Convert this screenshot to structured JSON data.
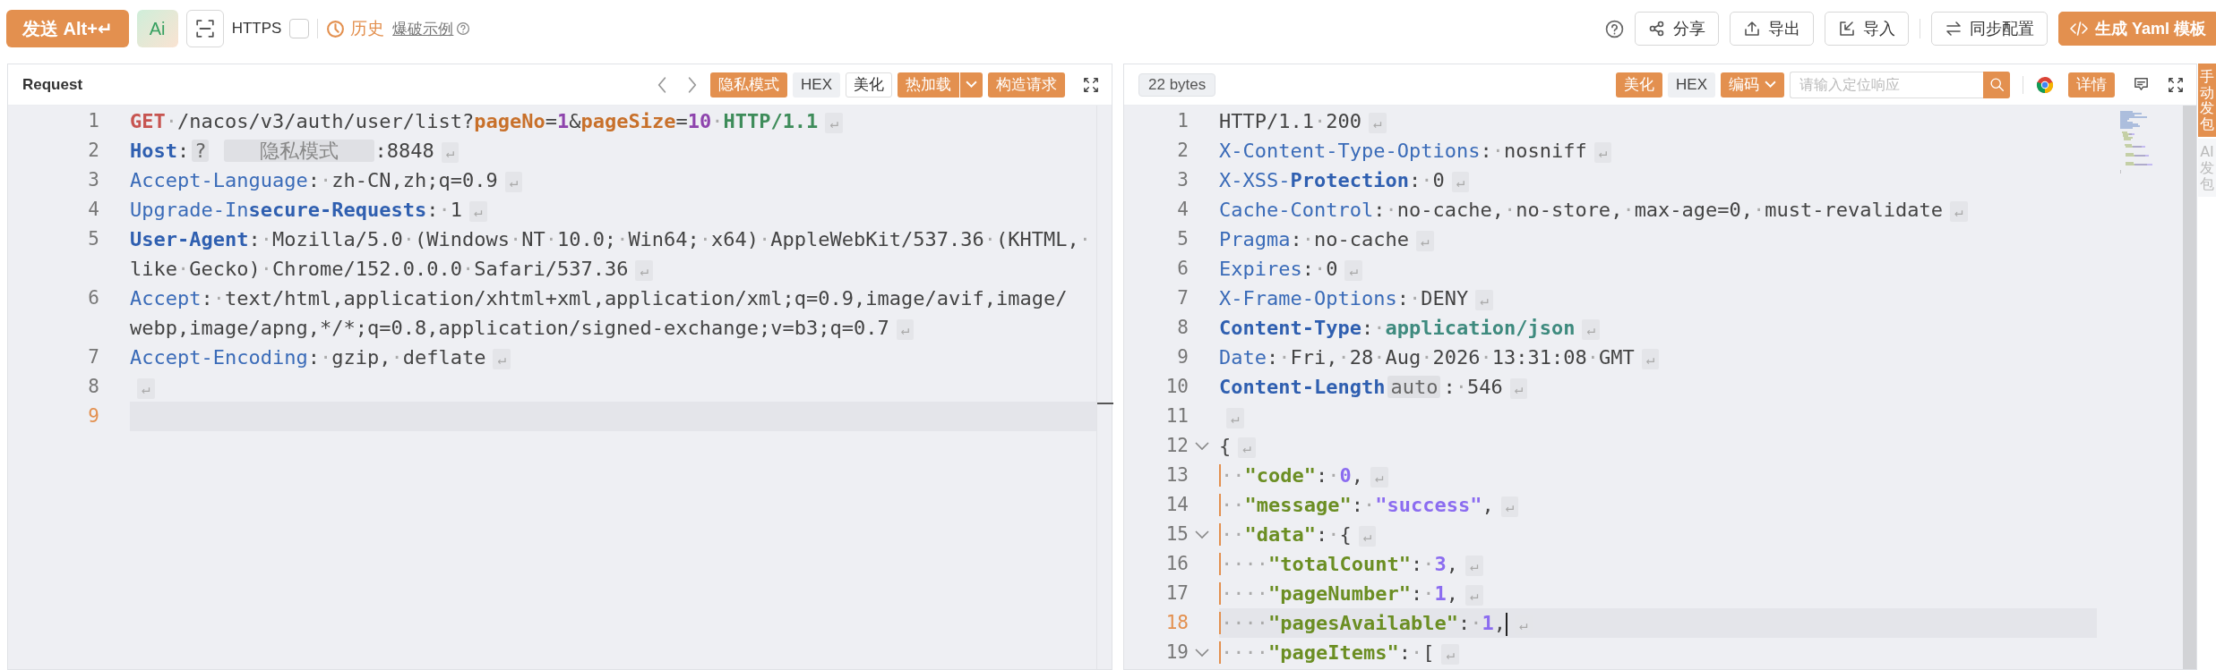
{
  "toolbar": {
    "send": {
      "label": "发送 Alt+↵"
    },
    "ai": {
      "label": "Ai"
    },
    "https": {
      "label": "HTTPS",
      "checked": false
    },
    "history": {
      "label": "历史"
    },
    "example": {
      "label": "爆破示例"
    },
    "actions": [
      {
        "label": "分享",
        "kind": "plain"
      },
      {
        "label": "导出",
        "kind": "plain"
      },
      {
        "label": "导入",
        "kind": "plain"
      },
      {
        "label": "同步配置",
        "kind": "plain"
      },
      {
        "label": "生成 Yaml 模板",
        "kind": "primary"
      }
    ]
  },
  "request": {
    "title": "Request",
    "buttons": [
      {
        "label": "隐私模式",
        "kind": "primary"
      },
      {
        "label": "HEX",
        "kind": "muted"
      },
      {
        "label": "美化",
        "kind": "outline"
      },
      {
        "label": "热加载",
        "kind": "primary",
        "menu": true
      },
      {
        "label": "构造请求",
        "kind": "primary"
      }
    ],
    "lines": [
      {
        "n": "1",
        "current": false,
        "tokens": [
          {
            "kind": "method",
            "text": "GET"
          },
          {
            "kind": "value",
            "text": "·/nacos/v3/auth/user/list?"
          },
          {
            "kind": "param",
            "text": "pageNo"
          },
          {
            "kind": "value",
            "text": "="
          },
          {
            "kind": "num",
            "text": "1"
          },
          {
            "kind": "value",
            "text": "&"
          },
          {
            "kind": "param",
            "text": "pageSize"
          },
          {
            "kind": "value",
            "text": "="
          },
          {
            "kind": "num",
            "text": "10"
          },
          {
            "kind": "value",
            "text": "·"
          },
          {
            "kind": "version",
            "text": "HTTP/1.1"
          },
          {
            "kind": "eol",
            "text": "↵"
          }
        ]
      },
      {
        "n": "2",
        "current": false,
        "tokens": [
          {
            "kind": "keyb",
            "text": "Host"
          },
          {
            "kind": "punct",
            "text": ":"
          },
          {
            "kind": "tag",
            "text": "?"
          },
          {
            "kind": "mask",
            "text": "隐私模式"
          },
          {
            "kind": "value",
            "text": ":8848"
          },
          {
            "kind": "eol",
            "text": "↵"
          }
        ]
      },
      {
        "n": "3",
        "current": false,
        "tokens": [
          {
            "kind": "key",
            "text": "Accept-Language"
          },
          {
            "kind": "punct",
            "text": ":"
          },
          {
            "kind": "value",
            "text": "·zh-CN,zh;q=0.9"
          },
          {
            "kind": "eol",
            "text": "↵"
          }
        ]
      },
      {
        "n": "4",
        "current": false,
        "tokens": [
          {
            "kind": "key",
            "text": "Upgrade-In"
          },
          {
            "kind": "keyb",
            "text": "secure-Requests"
          },
          {
            "kind": "punct",
            "text": ":"
          },
          {
            "kind": "value",
            "text": "·1"
          },
          {
            "kind": "eol",
            "text": "↵"
          }
        ]
      },
      {
        "n": "5",
        "current": false,
        "tokens": [
          {
            "kind": "keyb",
            "text": "User-Agent"
          },
          {
            "kind": "punct",
            "text": ":"
          },
          {
            "kind": "value",
            "text": "·Mozilla/5.0·(Windows·NT·10.0;·Win64;·x64)·AppleWebKit/537.36·(KHTML,·like·Gecko)·Chrome/152.0.0.0·Safari/537.36"
          },
          {
            "kind": "eol",
            "text": "↵"
          }
        ]
      },
      {
        "n": "6",
        "current": false,
        "tokens": [
          {
            "kind": "key",
            "text": "Accept"
          },
          {
            "kind": "punct",
            "text": ":"
          },
          {
            "kind": "value",
            "text": "·text/html,application/xhtml+xml,application/xml;q=0.9,image/avif,image/webp,image/apng,*/*;q=0.8,application/signed-exchange;v=b3;q=0.7"
          },
          {
            "kind": "eol",
            "text": "↵"
          }
        ]
      },
      {
        "n": "7",
        "current": false,
        "tokens": [
          {
            "kind": "key",
            "text": "Accept-Encoding"
          },
          {
            "kind": "punct",
            "text": ":"
          },
          {
            "kind": "value",
            "text": "·gzip,·deflate"
          },
          {
            "kind": "eol",
            "text": "↵"
          }
        ]
      },
      {
        "n": "8",
        "current": false,
        "tokens": [
          {
            "kind": "eol",
            "text": "↵"
          }
        ]
      },
      {
        "n": "9",
        "current": true
      }
    ]
  },
  "response": {
    "size": "22 bytes",
    "buttons": [
      {
        "label": "美化",
        "kind": "primary"
      },
      {
        "label": "HEX",
        "kind": "muted"
      },
      {
        "label": "编码",
        "kind": "primary",
        "menu": true
      }
    ],
    "search": {
      "placeholder": "请输入定位响应"
    },
    "detail": {
      "label": "详情"
    },
    "lines": [
      {
        "n": "1",
        "current": false,
        "tokens": [
          {
            "kind": "value",
            "text": "HTTP/1.1·200"
          },
          {
            "kind": "eol",
            "text": "↵"
          }
        ]
      },
      {
        "n": "2",
        "current": false,
        "tokens": [
          {
            "kind": "key",
            "text": "X-Content-Type-Options"
          },
          {
            "kind": "punct",
            "text": ":"
          },
          {
            "kind": "value",
            "text": "·nosniff"
          },
          {
            "kind": "eol",
            "text": "↵"
          }
        ]
      },
      {
        "n": "3",
        "current": false,
        "tokens": [
          {
            "kind": "key",
            "text": "X-XSS-"
          },
          {
            "kind": "keyb",
            "text": "Protection"
          },
          {
            "kind": "punct",
            "text": ":"
          },
          {
            "kind": "value",
            "text": "·0"
          },
          {
            "kind": "eol",
            "text": "↵"
          }
        ]
      },
      {
        "n": "4",
        "current": false,
        "tokens": [
          {
            "kind": "key",
            "text": "Cache-Control"
          },
          {
            "kind": "punct",
            "text": ":"
          },
          {
            "kind": "value",
            "text": "·no-cache,·no-store,·max-age=0,·must-revalidate"
          },
          {
            "kind": "eol",
            "text": "↵"
          }
        ]
      },
      {
        "n": "5",
        "current": false,
        "tokens": [
          {
            "kind": "key",
            "text": "Pragma"
          },
          {
            "kind": "punct",
            "text": ":"
          },
          {
            "kind": "value",
            "text": "·no-cache"
          },
          {
            "kind": "eol",
            "text": "↵"
          }
        ]
      },
      {
        "n": "6",
        "current": false,
        "tokens": [
          {
            "kind": "key",
            "text": "Expires"
          },
          {
            "kind": "punct",
            "text": ":"
          },
          {
            "kind": "value",
            "text": "·0"
          },
          {
            "kind": "eol",
            "text": "↵"
          }
        ]
      },
      {
        "n": "7",
        "current": false,
        "tokens": [
          {
            "kind": "key",
            "text": "X-Frame-Options"
          },
          {
            "kind": "punct",
            "text": ":"
          },
          {
            "kind": "value",
            "text": "·DENY"
          },
          {
            "kind": "eol",
            "text": "↵"
          }
        ]
      },
      {
        "n": "8",
        "current": false,
        "tokens": [
          {
            "kind": "keyb",
            "text": "Content-Type"
          },
          {
            "kind": "punct",
            "text": ":"
          },
          {
            "kind": "value",
            "text": "·"
          },
          {
            "kind": "ctype",
            "text": "application/json"
          },
          {
            "kind": "eol",
            "text": "↵"
          }
        ]
      },
      {
        "n": "9",
        "current": false,
        "tokens": [
          {
            "kind": "key",
            "text": "Date"
          },
          {
            "kind": "punct",
            "text": ":"
          },
          {
            "kind": "value",
            "text": "·Fri,·28·Aug·2026·13:31:08·GMT"
          },
          {
            "kind": "eol",
            "text": "↵"
          }
        ]
      },
      {
        "n": "10",
        "current": false,
        "tokens": [
          {
            "kind": "keyb",
            "text": "Content-Length"
          },
          {
            "kind": "tag",
            "text": "auto"
          },
          {
            "kind": "punct",
            "text": ":"
          },
          {
            "kind": "value",
            "text": "·546"
          },
          {
            "kind": "eol",
            "text": "↵"
          }
        ]
      },
      {
        "n": "11",
        "current": false,
        "tokens": [
          {
            "kind": "eol",
            "text": "↵"
          }
        ]
      },
      {
        "n": "12",
        "current": false,
        "expanded": true,
        "tokens": [
          {
            "kind": "brace",
            "text": "{"
          },
          {
            "kind": "eol",
            "text": "↵"
          }
        ]
      },
      {
        "n": "13",
        "current": false,
        "tokens": [
          {
            "kind": "indent",
            "text": "··"
          },
          {
            "kind": "jkey",
            "text": "\"code\""
          },
          {
            "kind": "punct",
            "text": ":"
          },
          {
            "kind": "value",
            "text": "·"
          },
          {
            "kind": "jnum",
            "text": "0"
          },
          {
            "kind": "punct",
            "text": ","
          },
          {
            "kind": "eol",
            "text": "↵"
          }
        ]
      },
      {
        "n": "14",
        "current": false,
        "tokens": [
          {
            "kind": "indent",
            "text": "··"
          },
          {
            "kind": "jkey",
            "text": "\"message\""
          },
          {
            "kind": "punct",
            "text": ":"
          },
          {
            "kind": "value",
            "text": "·"
          },
          {
            "kind": "jstr",
            "text": "\"success\""
          },
          {
            "kind": "punct",
            "text": ","
          },
          {
            "kind": "eol",
            "text": "↵"
          }
        ]
      },
      {
        "n": "15",
        "current": false,
        "expanded": true,
        "tokens": [
          {
            "kind": "indent",
            "text": "··"
          },
          {
            "kind": "jkey",
            "text": "\"data\""
          },
          {
            "kind": "punct",
            "text": ":"
          },
          {
            "kind": "value",
            "text": "·"
          },
          {
            "kind": "brace",
            "text": "{"
          },
          {
            "kind": "eol",
            "text": "↵"
          }
        ]
      },
      {
        "n": "16",
        "current": false,
        "tokens": [
          {
            "kind": "indent",
            "text": "····"
          },
          {
            "kind": "jkey",
            "text": "\"totalCount\""
          },
          {
            "kind": "punct",
            "text": ":"
          },
          {
            "kind": "value",
            "text": "·"
          },
          {
            "kind": "jnum",
            "text": "3"
          },
          {
            "kind": "punct",
            "text": ","
          },
          {
            "kind": "eol",
            "text": "↵"
          }
        ]
      },
      {
        "n": "17",
        "current": false,
        "tokens": [
          {
            "kind": "indent",
            "text": "····"
          },
          {
            "kind": "jkey",
            "text": "\"pageNumber\""
          },
          {
            "kind": "punct",
            "text": ":"
          },
          {
            "kind": "value",
            "text": "·"
          },
          {
            "kind": "jnum",
            "text": "1"
          },
          {
            "kind": "punct",
            "text": ","
          },
          {
            "kind": "eol",
            "text": "↵"
          }
        ]
      },
      {
        "n": "18",
        "current": true,
        "tokens": [
          {
            "kind": "indent",
            "text": "····"
          },
          {
            "kind": "jkey",
            "text": "\"pagesAvailable\""
          },
          {
            "kind": "punct",
            "text": ":"
          },
          {
            "kind": "value",
            "text": "·"
          },
          {
            "kind": "jnum",
            "text": "1"
          },
          {
            "kind": "punct",
            "text": ","
          },
          {
            "kind": "cursor"
          },
          {
            "kind": "eol",
            "text": "↵"
          }
        ]
      },
      {
        "n": "19",
        "current": false,
        "expanded": true,
        "tokens": [
          {
            "kind": "indent",
            "text": "····"
          },
          {
            "kind": "jkey",
            "text": "\"pageItems\""
          },
          {
            "kind": "punct",
            "text": ":"
          },
          {
            "kind": "value",
            "text": "·"
          },
          {
            "kind": "brace",
            "text": "["
          },
          {
            "kind": "eol",
            "text": "↵"
          }
        ]
      }
    ]
  },
  "side_tabs": [
    {
      "label": "手动发包",
      "selected": true
    },
    {
      "label": "AI发包",
      "selected": false
    }
  ]
}
